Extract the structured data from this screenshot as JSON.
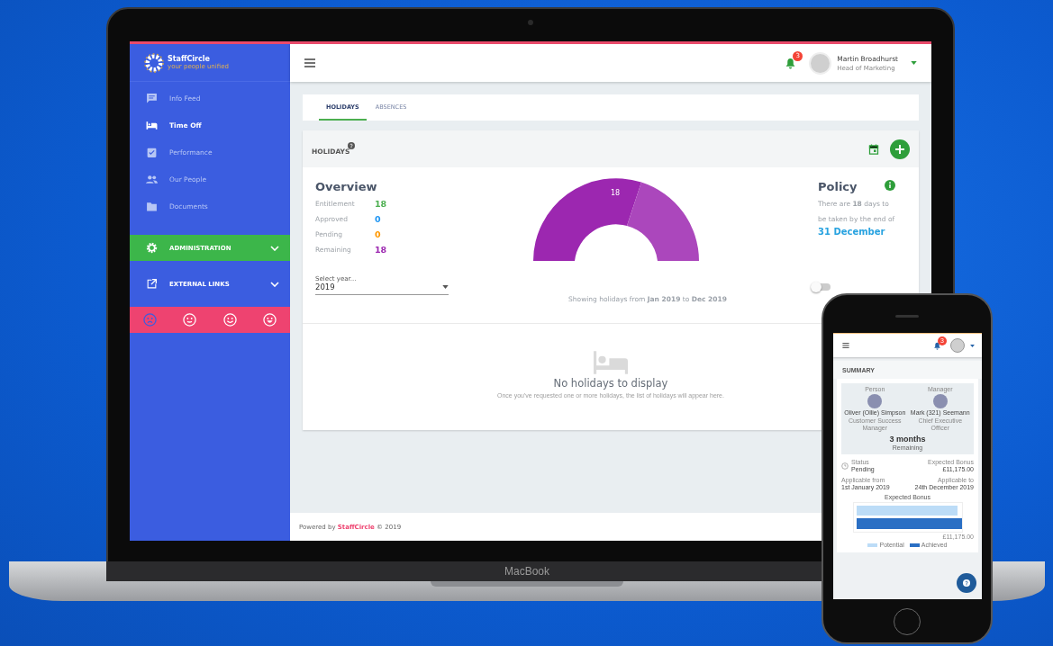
{
  "laptop": {
    "brand": "MacBook",
    "sidebar": {
      "logo": {
        "name": "StaffCircle",
        "tagline": "your people unified"
      },
      "items": [
        {
          "label": "Info Feed",
          "selected": false
        },
        {
          "label": "Time Off",
          "selected": true
        },
        {
          "label": "Performance",
          "selected": false
        },
        {
          "label": "Our People",
          "selected": false
        },
        {
          "label": "Documents",
          "selected": false
        }
      ],
      "sections": [
        {
          "label": "ADMINISTRATION",
          "selected": true
        },
        {
          "label": "EXTERNAL LINKS",
          "selected": false
        }
      ],
      "moods": [
        {
          "kind": "sad",
          "selected": true
        },
        {
          "kind": "neutral",
          "selected": false
        },
        {
          "kind": "happy",
          "selected": false
        },
        {
          "kind": "laughing",
          "selected": false
        }
      ]
    },
    "header": {
      "notifications": "3",
      "user": {
        "name": "Martin Broadhurst",
        "role": "Head of Marketing"
      }
    },
    "tabs": [
      {
        "label": "HOLIDAYS",
        "selected": true
      },
      {
        "label": "ABSENCES",
        "selected": false
      }
    ],
    "holidays": {
      "title": "HOLIDAYS",
      "overview": {
        "title": "Overview",
        "rows": [
          {
            "label": "Entitlement",
            "value": "18",
            "color": "#4caf50"
          },
          {
            "label": "Approved",
            "value": "0",
            "color": "#2196f3"
          },
          {
            "label": "Pending",
            "value": "0",
            "color": "#ff9800"
          },
          {
            "label": "Remaining",
            "value": "18",
            "color": "#9c27b0"
          }
        ]
      },
      "gauge_label": "18",
      "year": {
        "label": "Select year...",
        "value": "2019"
      },
      "range": "Showing holidays from **Jan 2019** to **Dec 2019**",
      "toggle": {
        "on": false
      },
      "policy": {
        "title": "Policy",
        "text": "There are **18** days to be taken by the end of",
        "date": "31 December"
      },
      "empty": {
        "title": "No holidays to display",
        "text": "Once you've requested one or more holidays, the list of holidays will appear here."
      }
    },
    "footer": {
      "prefix": "Powered by",
      "brand": "StaffCircle",
      "suffix": "© 2019"
    }
  },
  "phone": {
    "notifications": "3",
    "section": "SUMMARY",
    "people": [
      {
        "role": "Person",
        "name": "Oliver (Ollie) Simpson",
        "title": "Customer Success Manager"
      },
      {
        "role": "Manager",
        "name": "Mark (321) Seemann",
        "title": "Chief Executive Officer"
      }
    ],
    "duration": "3 months",
    "duration_label": "Remaining",
    "status": {
      "label": "Status",
      "value": "Pending"
    },
    "bonus": {
      "label": "Expected Bonus",
      "value": "£11,175.00"
    },
    "from": {
      "label": "Applicable from",
      "value": "1st January 2019"
    },
    "to": {
      "label": "Applicable to",
      "value": "24th December 2019"
    },
    "chart": {
      "title": "Expected Bonus",
      "axis_label": "£11,175.00",
      "legend": [
        "Potential",
        "Achieved"
      ]
    }
  }
}
